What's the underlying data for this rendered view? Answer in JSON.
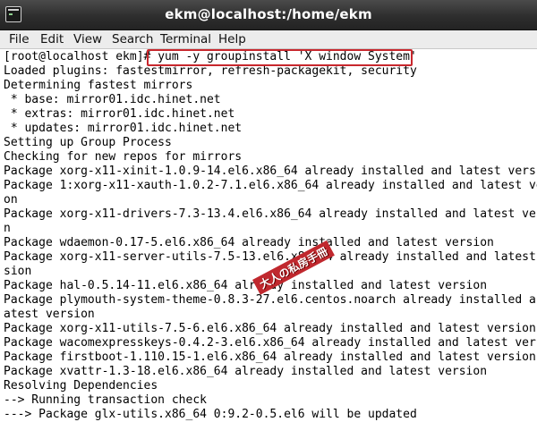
{
  "window": {
    "title": "ekm@localhost:/home/ekm",
    "icon": "terminal-icon"
  },
  "menu": {
    "items": [
      "File",
      "Edit",
      "View",
      "Search",
      "Terminal",
      "Help"
    ]
  },
  "terminal": {
    "prompt": "[root@localhost ekm]# ",
    "command": "yum -y groupinstall 'X window System'",
    "lines": [
      "Loaded plugins: fastestmirror, refresh-packagekit, security",
      "Determining fastest mirrors",
      " * base: mirror01.idc.hinet.net",
      " * extras: mirror01.idc.hinet.net",
      " * updates: mirror01.idc.hinet.net",
      "Setting up Group Process",
      "Checking for new repos for mirrors",
      "Package xorg-x11-xinit-1.0.9-14.el6.x86_64 already installed and latest version",
      "Package 1:xorg-x11-xauth-1.0.2-7.1.el6.x86_64 already installed and latest versi",
      "on",
      "Package xorg-x11-drivers-7.3-13.4.el6.x86_64 already installed and latest versio",
      "n",
      "Package wdaemon-0.17-5.el6.x86_64 already installed and latest version",
      "Package xorg-x11-server-utils-7.5-13.el6.x86_64 already installed and latest ver",
      "sion",
      "Package hal-0.5.14-11.el6.x86_64 already installed and latest version",
      "Package plymouth-system-theme-0.8.3-27.el6.centos.noarch already installed and l",
      "atest version",
      "Package xorg-x11-utils-7.5-6.el6.x86_64 already installed and latest version",
      "Package wacomexpresskeys-0.4.2-3.el6.x86_64 already installed and latest version",
      "Package firstboot-1.110.15-1.el6.x86_64 already installed and latest version",
      "Package xvattr-1.3-18.el6.x86_64 already installed and latest version",
      "Resolving Dependencies",
      "--> Running transaction check",
      "---> Package glx-utils.x86_64 0:9.2-0.5.el6 will be updated"
    ]
  },
  "highlight": {
    "color": "#c8272d"
  },
  "watermark": {
    "text": "大人の私房手冊"
  }
}
